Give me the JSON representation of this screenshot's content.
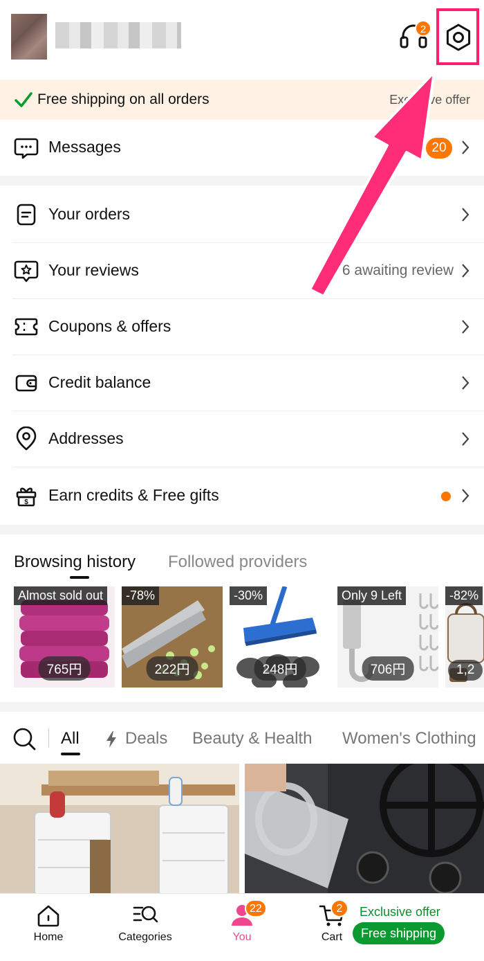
{
  "header": {
    "support_badge": "2"
  },
  "banner": {
    "text": "Free shipping on all orders",
    "right_text": "Exclusive offer"
  },
  "menu": {
    "messages": {
      "label": "Messages",
      "badge": "20"
    },
    "orders": {
      "label": "Your orders"
    },
    "reviews": {
      "label": "Your reviews",
      "sub": "6 awaiting review"
    },
    "coupons": {
      "label": "Coupons & offers"
    },
    "credit": {
      "label": "Credit balance"
    },
    "addresses": {
      "label": "Addresses"
    },
    "earn": {
      "label": "Earn credits & Free gifts"
    }
  },
  "history": {
    "tabs": [
      "Browsing history",
      "Followed providers"
    ],
    "items": [
      {
        "tag": "Almost sold out",
        "price": "765円"
      },
      {
        "tag": "-78%",
        "price": "222円"
      },
      {
        "tag": "-30%",
        "price": "248円"
      },
      {
        "tag": "Only 9 Left",
        "price": "706円"
      },
      {
        "tag": "-82%",
        "price": "1,2"
      }
    ]
  },
  "categories": {
    "all": "All",
    "items": [
      "Deals",
      "Beauty & Health",
      "Women's Clothing"
    ]
  },
  "bottom_nav": {
    "home": "Home",
    "categories": "Categories",
    "you": "You",
    "you_badge": "22",
    "cart": "Cart",
    "cart_badge": "2",
    "exclusive": "Exclusive offer",
    "free_shipping": "Free shipping"
  },
  "colors": {
    "accent": "#fb7701",
    "green": "#0b9a2f",
    "highlight": "#ff1f6e"
  }
}
